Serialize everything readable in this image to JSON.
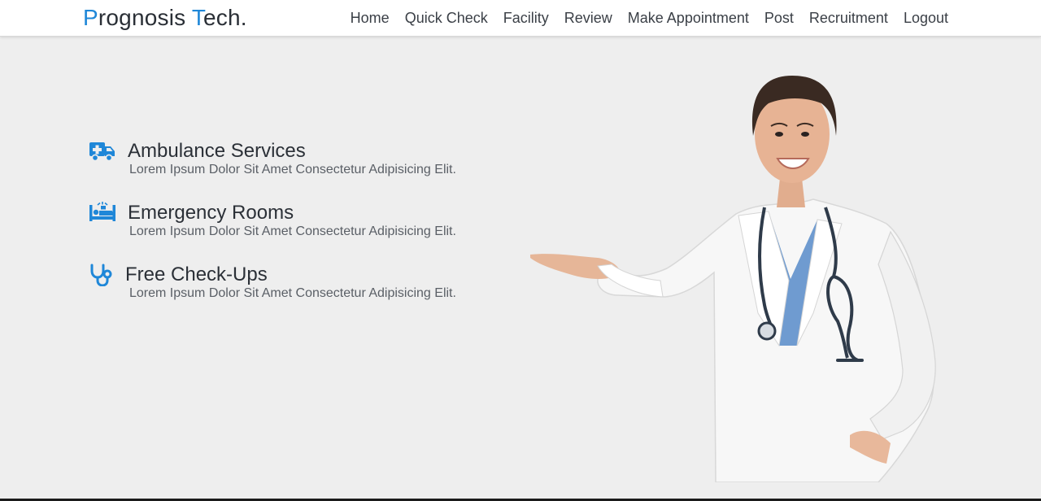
{
  "brand": {
    "first_initial": "P",
    "first_rest": "rognosis ",
    "second_initial": "T",
    "second_rest": "ech."
  },
  "nav": {
    "items": [
      {
        "label": "Home"
      },
      {
        "label": "Quick Check"
      },
      {
        "label": "Facility"
      },
      {
        "label": "Review"
      },
      {
        "label": "Make Appointment"
      },
      {
        "label": "Post"
      },
      {
        "label": "Recruitment"
      },
      {
        "label": "Logout"
      }
    ]
  },
  "services": [
    {
      "title": "Ambulance Services",
      "description": "Lorem Ipsum Dolor Sit Amet Consectetur Adipisicing Elit.",
      "icon": "ambulance-icon"
    },
    {
      "title": "Emergency Rooms",
      "description": "Lorem Ipsum Dolor Sit Amet Consectetur Adipisicing Elit.",
      "icon": "procedure-bed-icon"
    },
    {
      "title": "Free Check-Ups",
      "description": "Lorem Ipsum Dolor Sit Amet Consectetur Adipisicing Elit.",
      "icon": "stethoscope-icon"
    }
  ],
  "colors": {
    "accent": "#1f87d8",
    "background": "#eeeeee",
    "text": "#2b3037"
  }
}
